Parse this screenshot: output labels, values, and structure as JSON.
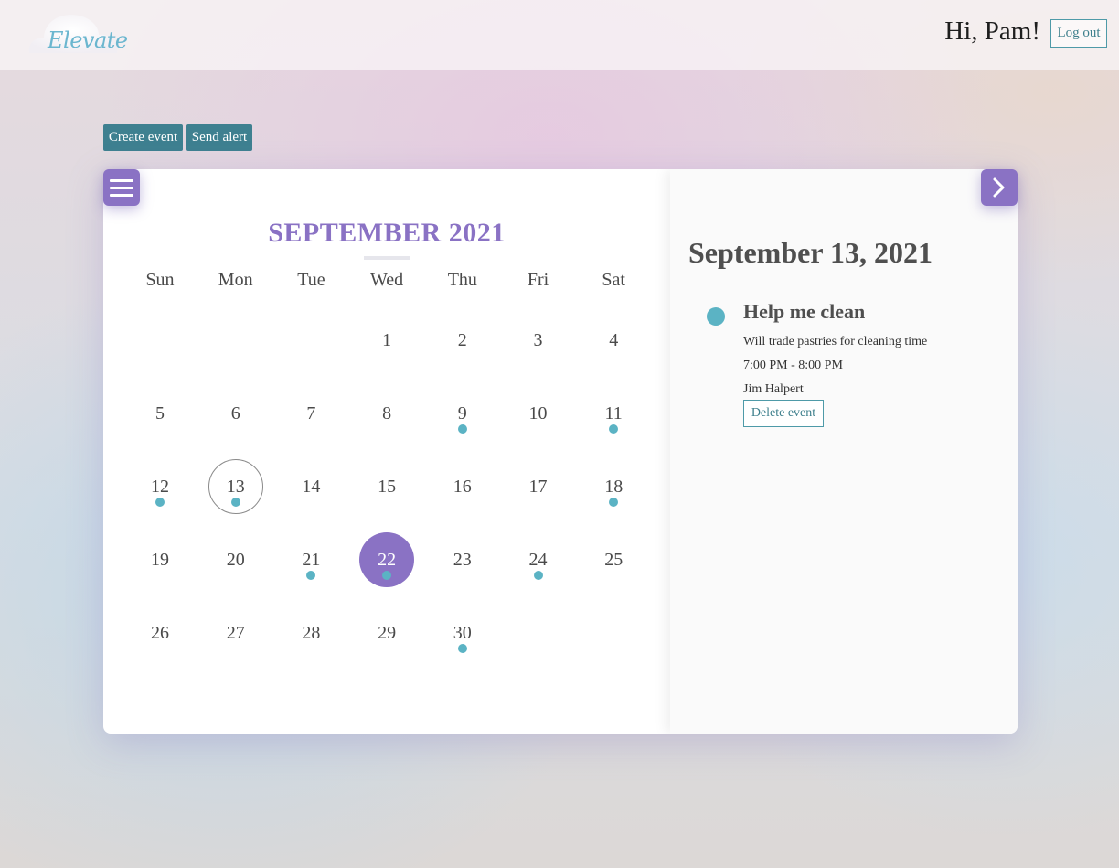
{
  "header": {
    "logo_text": "Elevate",
    "greeting": "Hi, Pam!",
    "logout_label": "Log out"
  },
  "toolbar": {
    "create_event_label": "Create event",
    "send_alert_label": "Send alert"
  },
  "calendar": {
    "month_title": "SEPTEMBER 2021",
    "weekdays": [
      "Sun",
      "Mon",
      "Tue",
      "Wed",
      "Thu",
      "Fri",
      "Sat"
    ],
    "first_weekday_index": 3,
    "days_in_month": 30,
    "outlined_day": 13,
    "selected_day": 22,
    "event_days": [
      9,
      11,
      12,
      13,
      18,
      21,
      22,
      24,
      30
    ]
  },
  "details": {
    "date_heading": "September 13, 2021",
    "event": {
      "title": "Help me clean",
      "description": "Will trade pastries for cleaning time",
      "time": "7:00 PM - 8:00 PM",
      "host": "Jim Halpert",
      "delete_label": "Delete event"
    }
  },
  "colors": {
    "accent_purple": "#8a72c4",
    "event_teal": "#5bb3c4",
    "button_teal": "#3e8090"
  },
  "icons": {
    "menu": "hamburger-menu-icon",
    "next": "chevron-right-icon",
    "logo": "cloud-logo-icon"
  }
}
